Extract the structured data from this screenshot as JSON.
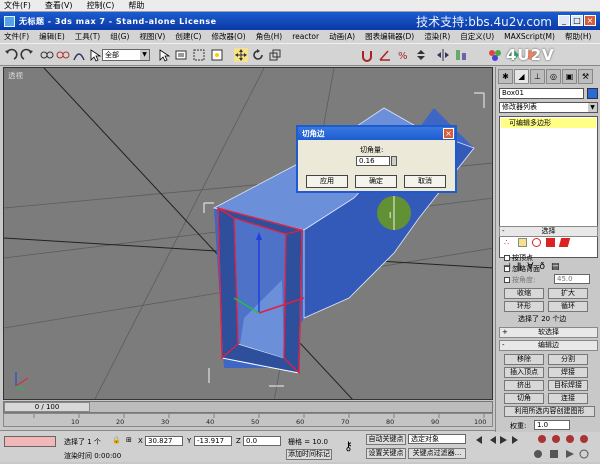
{
  "outer_menu": [
    "文件(F)",
    "查看(V)",
    "控制(C)",
    "帮助"
  ],
  "window": {
    "title": "无标题 - 3ds max 7 - Stand-alone License",
    "watermark": "技术支持:bbs.4u2v.com",
    "brand_logo": "4U2V"
  },
  "app_menu": [
    "文件(F)",
    "编辑(E)",
    "工具(T)",
    "组(G)",
    "视图(V)",
    "创建(C)",
    "修改器(O)",
    "角色(H)",
    "reactor",
    "动画(A)",
    "图表编辑器(D)",
    "渲染(R)",
    "自定义(U)",
    "MAXScript(M)",
    "帮助(H)"
  ],
  "toolbar": {
    "selection_filter": "全部"
  },
  "viewport": {
    "label": "透视"
  },
  "command_panel": {
    "object_name": "Box01",
    "object_color": "#2a6ad8",
    "modifier_list": "修改器列表",
    "stack_item": "可编辑多边形",
    "selection": {
      "header": "选择",
      "by_vertex": "按顶点",
      "ignore_backfacing": "忽略背面",
      "by_angle": "按角度:",
      "angle_value": "45.0",
      "shrink": "收缩",
      "grow": "扩大",
      "ring": "环形",
      "loop": "循环",
      "status": "选择了 20 个边"
    },
    "soft_selection": {
      "header": "软选择"
    },
    "edit_edges": {
      "header": "编辑边",
      "remove": "移除",
      "split": "分割",
      "insert_vertex": "插入顶点",
      "weld": "焊接",
      "extrude": "挤出",
      "target_weld": "目标焊接",
      "chamfer": "切角",
      "connect": "连接",
      "create_shape": "利用所选内容创建图形",
      "weight_label": "权重:",
      "weight_value": "1.0"
    }
  },
  "dialog": {
    "title": "切角边",
    "field_label": "切角量:",
    "field_value": "0.16",
    "apply": "应用",
    "ok": "确定",
    "cancel": "取消"
  },
  "timeline": {
    "frame_display": "0 / 100",
    "ticks": [
      "10",
      "20",
      "30",
      "40",
      "50",
      "60",
      "70",
      "80",
      "90",
      "100"
    ]
  },
  "status": {
    "selection_text": "选择了 1 个",
    "x_label": "X",
    "x_value": "30.827",
    "y_label": "Y",
    "y_value": "-13.917",
    "z_label": "Z",
    "z_value": "0.0",
    "grid_text": "栅格 = 10.0",
    "prompt_text": "渲染时间  0:00:00",
    "add_time_tag": "添加时间标记",
    "auto_key": "自动关键点",
    "selected_set": "选定对象",
    "set_key": "设置关键点",
    "key_filters": "关键点过滤器..."
  },
  "colors": {
    "title_bar": "#0a3aa6",
    "viewport_bg": "#7c7c7c",
    "box_blue": "#2f5cc0",
    "selected_edge": "#e02040"
  }
}
